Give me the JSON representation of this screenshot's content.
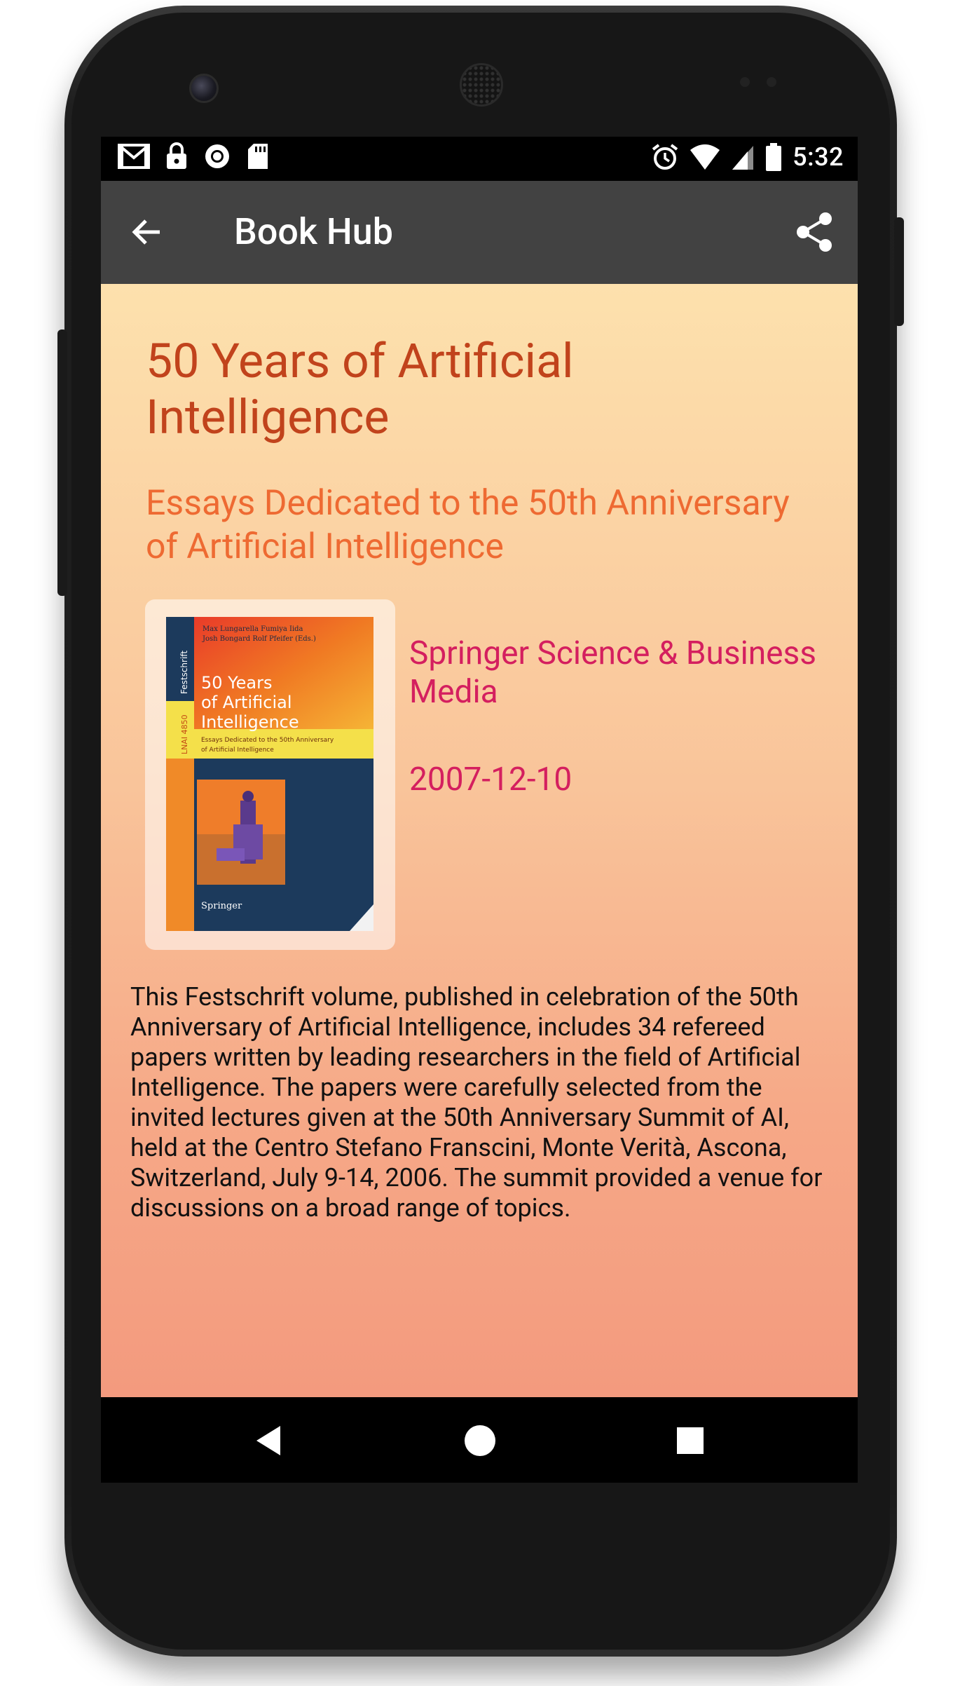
{
  "status_bar": {
    "time": "5:32",
    "left_icons": [
      "gmail-icon",
      "lock-icon",
      "sync-circle-icon",
      "sd-card-icon"
    ],
    "right_icons": [
      "alarm-icon",
      "wifi-icon",
      "signal-icon",
      "battery-icon"
    ]
  },
  "app_bar": {
    "title": "Book Hub",
    "back_icon": "arrow-left-icon",
    "share_icon": "share-icon"
  },
  "book": {
    "title": "50 Years of Artificial Intelligence",
    "subtitle": "Essays Dedicated to the 50th Anniversary of Artificial Intelligence",
    "publisher": "Springer Science & Business Media",
    "published_date": "2007-12-10",
    "description": "This Festschrift volume, published in celebration of the 50th Anniversary of Artificial Intelligence, includes 34 refereed papers written by leading researchers in the field of Artificial Intelligence. The papers were carefully selected from the invited lectures given at the 50th Anniversary Summit of AI, held at the Centro Stefano Franscini, Monte Verità, Ascona, Switzerland, July 9-14, 2006. The summit provided a venue for discussions on a broad range of topics.",
    "cover": {
      "editors_line1": "Max Lungarella   Fumiya Iida",
      "editors_line2": "Josh Bongard   Rolf Pfeifer (Eds.)",
      "series_label": "Festschrift",
      "lncs_label": "LNAI 4850",
      "title_line1": "50 Years",
      "title_line2": "of Artificial",
      "title_line3": "Intelligence",
      "subtitle_line1": "Essays Dedicated to the 50th Anniversary",
      "subtitle_line2": "of Artificial Intelligence",
      "publisher_logo": "Springer"
    }
  },
  "nav_bar": {
    "back": "triangle-back-icon",
    "home": "circle-home-icon",
    "recents": "square-recents-icon"
  },
  "colors": {
    "app_bar": "#424242",
    "title": "#c1431c",
    "subtitle": "#ee6a32",
    "publisher": "#d41f5f",
    "gradient_top": "#fde1ad",
    "gradient_bottom": "#f39a7e"
  }
}
